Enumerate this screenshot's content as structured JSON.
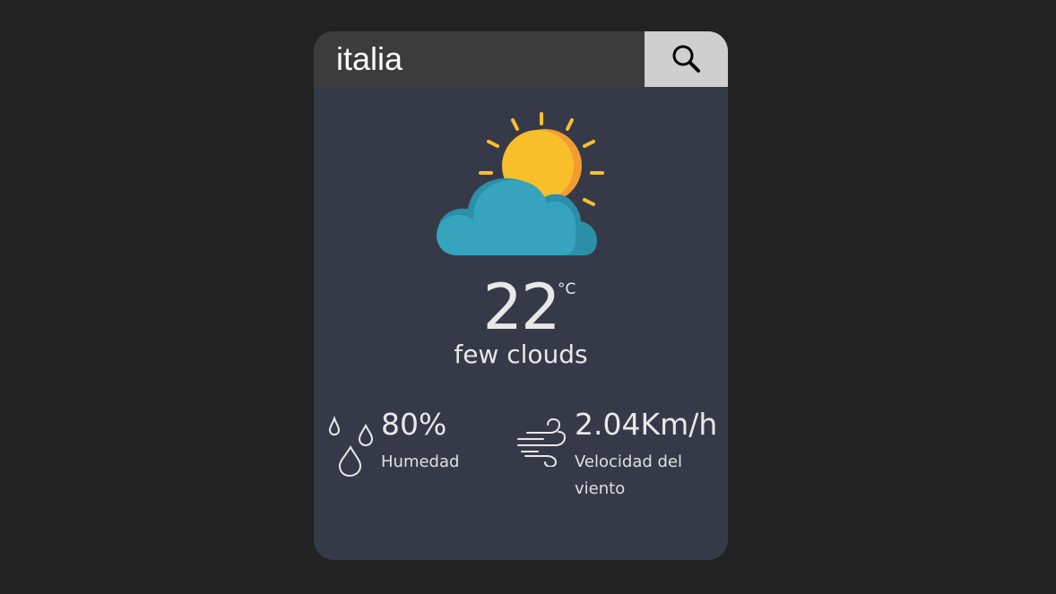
{
  "search": {
    "value": "italia",
    "button_icon": "search-icon"
  },
  "weather": {
    "icon": "partly-cloudy-icon",
    "temperature": "22",
    "unit": "°C",
    "description": "few clouds"
  },
  "humidity": {
    "icon": "water-drops-icon",
    "value": "80%",
    "label": "Humedad"
  },
  "wind": {
    "icon": "wind-icon",
    "value": "2.04Km/h",
    "label": "Velocidad del viento"
  },
  "colors": {
    "page_background": "#222222",
    "card_background": "#363a48",
    "search_background": "#3c3c3c",
    "button_background": "#cfcfcf",
    "sun": "#f9bf2b",
    "sun_shade": "#f39c32",
    "cloud": "#35a4bc",
    "cloud_shade": "#2b8fa8",
    "text": "#e8e8e8"
  }
}
